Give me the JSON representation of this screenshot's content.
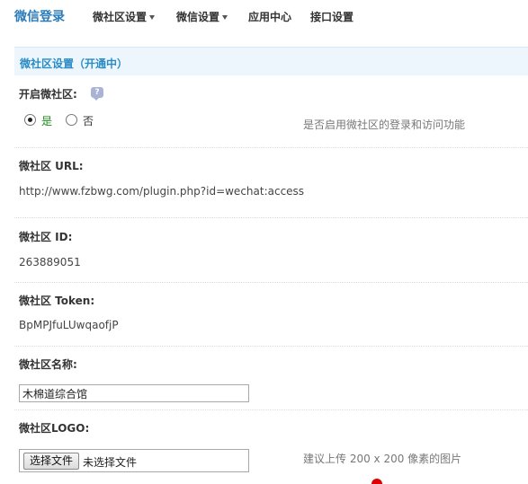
{
  "nav": {
    "brand": "微信登录",
    "items": [
      {
        "label": "微社区设置",
        "has_caret": true
      },
      {
        "label": "微信设置",
        "has_caret": true
      },
      {
        "label": "应用中心",
        "has_caret": false
      },
      {
        "label": "接口设置",
        "has_caret": false
      }
    ]
  },
  "section": {
    "title": "微社区设置（开通中）"
  },
  "form": {
    "enable": {
      "label": "开启微社区:",
      "help_icon": "help-bubble-icon",
      "options": [
        {
          "label": "是",
          "checked": true
        },
        {
          "label": "否",
          "checked": false
        }
      ],
      "hint": "是否启用微社区的登录和访问功能"
    },
    "url": {
      "label": "微社区 URL:",
      "value": "http://www.fzbwg.com/plugin.php?id=wechat:access"
    },
    "id": {
      "label": "微社区 ID:",
      "value": "263889051"
    },
    "token": {
      "label": "微社区 Token:",
      "value": "BpMPJfuLUwqaofjP"
    },
    "name": {
      "label": "微社区名称:",
      "value": "木棉道综合馆"
    },
    "logo": {
      "label": "微社区LOGO:",
      "button_label": "选择文件",
      "file_status": "未选择文件",
      "hint": "建议上传 200 x 200 像素的图片"
    }
  },
  "colors": {
    "brand": "#2b7bb9",
    "section_title": "#2a8bc5",
    "yes_option": "#1f8a1f"
  }
}
